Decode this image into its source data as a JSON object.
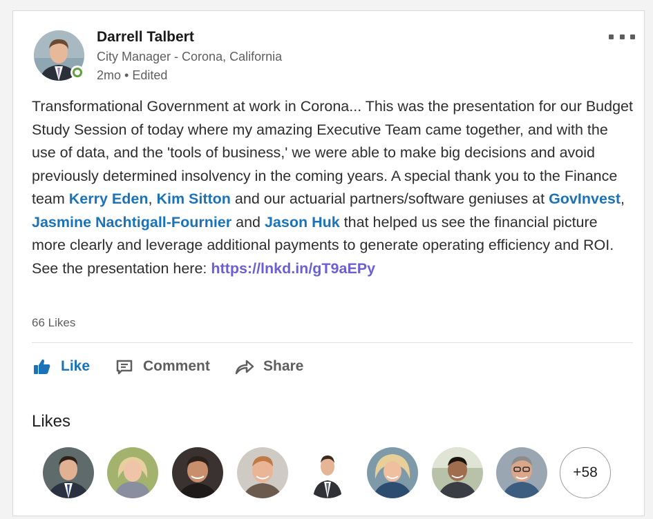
{
  "post": {
    "author": {
      "name": "Darrell Talbert",
      "headline": "City Manager - Corona, California",
      "meta": "2mo • Edited",
      "presence": "online"
    },
    "more_icon": "more-horizontal-icon",
    "text": {
      "segment_1": "Transformational Government at work in Corona... This was the presentation for our Budget Study Session of today where my amazing Executive Team came together, and with the use of data, and the 'tools of business,' we were able to make big decisions and avoid previously determined insolvency in the coming years. A special thank you to the Finance team ",
      "mention_1": "Kerry Eden",
      "segment_2": ", ",
      "mention_2": "Kim Sitton",
      "segment_3": " and our actuarial partners/software geniuses at ",
      "mention_3": "GovInvest",
      "segment_4": ", ",
      "mention_4": "Jasmine Nachtigall-Fournier",
      "segment_5": " and ",
      "mention_5": "Jason Huk",
      "segment_6": " that helped us see the financial picture more clearly and leverage additional payments to generate operating efficiency and ROI. See the presentation here: ",
      "link": "https://lnkd.in/gT9aEPy"
    },
    "likes_count": "66 Likes",
    "actions": {
      "like": {
        "label": "Like",
        "icon": "thumbs-up-icon"
      },
      "comment": {
        "label": "Comment",
        "icon": "comment-icon"
      },
      "share": {
        "label": "Share",
        "icon": "share-arrow-icon"
      }
    },
    "likes_section": {
      "heading": "Likes",
      "more": "+58"
    }
  },
  "colors": {
    "accent": "#1a73b8",
    "link": "#6b5fd4",
    "presence": "#5ea13c",
    "muted_text": "#5e5e5e"
  }
}
